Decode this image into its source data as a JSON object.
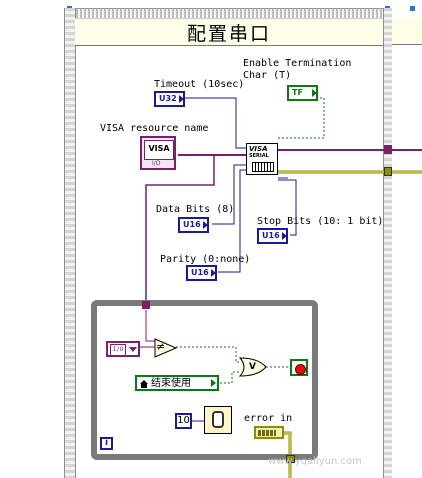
{
  "sequence_frame": {
    "title": "配置串口"
  },
  "controls": {
    "timeout_label": "Timeout (10sec)",
    "timeout_type": "U32",
    "visa_resource_label": "VISA resource name",
    "visa_resource_icon_text": "VISA",
    "visa_resource_icon_sub": "I/O",
    "enable_termination_label_line1": "Enable Termination",
    "enable_termination_label_line2": "Char (T)",
    "enable_termination_type": "TF",
    "data_bits_label": "Data Bits (8)",
    "data_bits_type": "U16",
    "stop_bits_label": "Stop Bits (10: 1 bit)",
    "stop_bits_type": "U16",
    "parity_label": "Parity (0:none)",
    "parity_type": "U16"
  },
  "serial_config_node": {
    "text_top": "VISA",
    "text_bottom": "SERIAL"
  },
  "while_loop": {
    "stop_button_label": "结束使用",
    "not_equal_symbol": "≠",
    "or_symbol": "V",
    "wait_constant": "10",
    "error_in_label": "error in",
    "iteration_symbol": "i"
  },
  "watermark": "www.yqaliyun.com",
  "colors": {
    "frame_border": "#a8a8a8",
    "frame_title_bg": "#fdfde8",
    "integer_blue": "#1a1aa0",
    "boolean_green": "#0b7a10",
    "visa_purple": "#7b1f6e",
    "error_cluster": "#8c8c0a",
    "loop_gray": "#7a7a7a"
  }
}
